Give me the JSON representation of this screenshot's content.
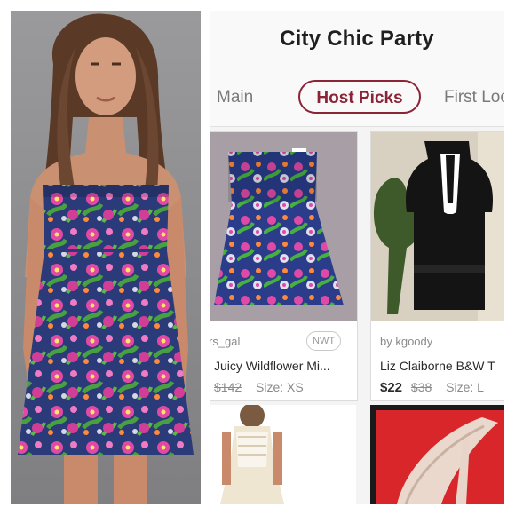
{
  "app": {
    "title": "City Chic Party"
  },
  "tabs": [
    {
      "label": "Main",
      "selected": false
    },
    {
      "label": "Host Picks",
      "selected": true
    },
    {
      "label": "First Loo",
      "selected": false
    }
  ],
  "listings": [
    {
      "seller": "rs_gal",
      "badge": "NWT",
      "title": "Juicy Wildflower Mi...",
      "price": "",
      "original_price": "$142",
      "size": "Size: XS"
    },
    {
      "seller": "by kgoody",
      "badge": "",
      "title": "Liz Claiborne B&W T",
      "price": "$22",
      "original_price": "$38",
      "size": "Size: L"
    }
  ],
  "colors": {
    "accent": "#8b2436",
    "dress_navy": "#2b3a78",
    "flower_pink": "#e04aa6",
    "leaf_green": "#48a040",
    "shoe_red": "#d8262a"
  }
}
